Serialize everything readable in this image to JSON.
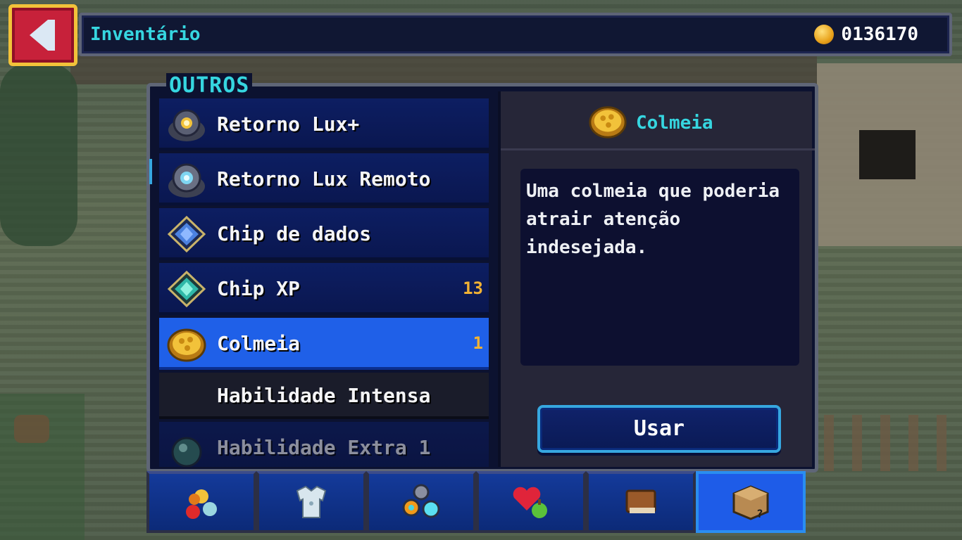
{
  "header": {
    "title": "Inventário",
    "coins": "0136170"
  },
  "section_label": "OUTROS",
  "items": [
    {
      "label": "Retorno Lux+",
      "count": "",
      "icon": "lux-return-plus-icon"
    },
    {
      "label": "Retorno Lux Remoto",
      "count": "",
      "icon": "lux-return-remote-icon"
    },
    {
      "label": "Chip de dados",
      "count": "",
      "icon": "data-chip-icon"
    },
    {
      "label": "Chip XP",
      "count": "13",
      "icon": "xp-chip-icon"
    },
    {
      "label": "Colmeia",
      "count": "1",
      "icon": "beehive-icon"
    },
    {
      "label": "Habilidade Intensa",
      "count": "",
      "icon": ""
    },
    {
      "label": "Habilidade Extra 1",
      "count": "",
      "icon": "skill-orb-icon"
    }
  ],
  "detail": {
    "title": "Colmeia",
    "description": "Uma colmeia que poderia atrair atenção indesejada.",
    "use_label": "Usar"
  },
  "tabs": [
    {
      "name": "food",
      "icon": "fruits-icon"
    },
    {
      "name": "armor",
      "icon": "armor-icon"
    },
    {
      "name": "gems",
      "icon": "gems-icon"
    },
    {
      "name": "healing",
      "icon": "heart-icon"
    },
    {
      "name": "books",
      "icon": "book-icon"
    },
    {
      "name": "others",
      "icon": "box-icon",
      "active": true
    }
  ],
  "colors": {
    "accent": "#36d6e0",
    "selected": "#1f60e8",
    "count": "#f2b233",
    "back_button": "#c7213a"
  }
}
